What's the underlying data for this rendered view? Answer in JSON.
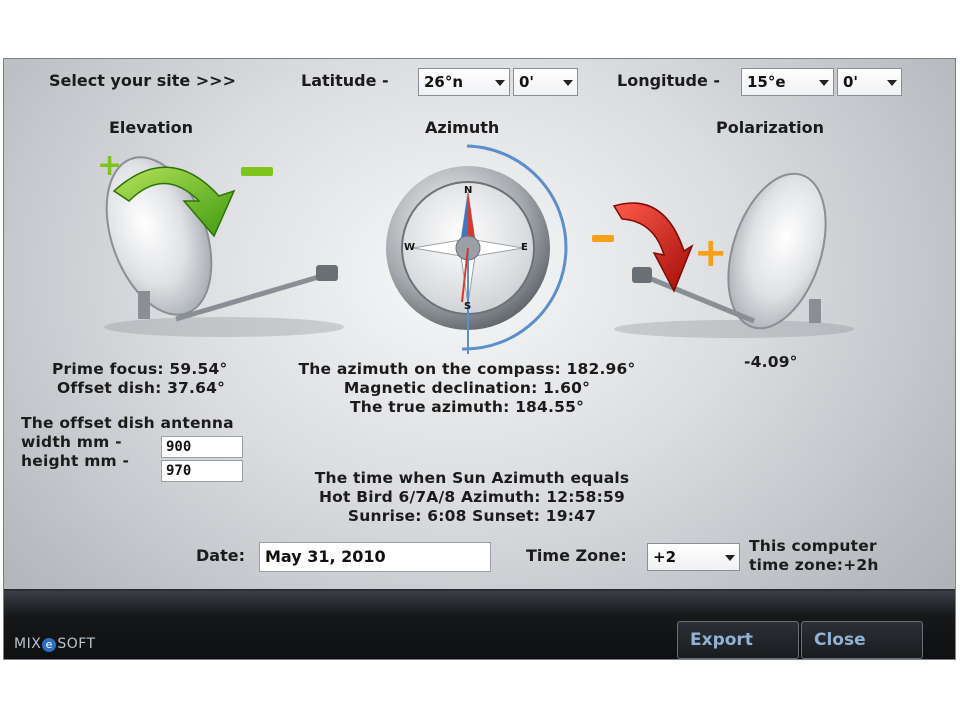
{
  "site": {
    "select_label": "Select your site >>>",
    "latitude_label": "Latitude -",
    "latitude_deg": "26°n",
    "latitude_min": "0'",
    "longitude_label": "Longitude -",
    "longitude_deg": "15°e",
    "longitude_min": "0'"
  },
  "headings": {
    "elevation": "Elevation",
    "azimuth": "Azimuth",
    "polarization": "Polarization"
  },
  "elevation": {
    "plus": "+",
    "minus": "−",
    "prime_focus": "Prime focus: 59.54°",
    "offset_dish": "Offset dish: 37.64°"
  },
  "compass": {
    "north": "N",
    "south": "S",
    "east": "E",
    "west": "W",
    "azimuth_on_compass": "The azimuth on the compass: 182.96°",
    "magnetic_declination": "Magnetic declination: 1.60°",
    "true_azimuth": "The true azimuth: 184.55°"
  },
  "polarization": {
    "minus": "−",
    "plus": "+",
    "value": "-4.09°"
  },
  "antenna": {
    "title": "The offset dish antenna",
    "width_label": "width  mm -",
    "height_label": "height mm -",
    "width_value": "900",
    "height_value": "970"
  },
  "sun": {
    "line1": "The time when Sun Azimuth equals",
    "line2": "Hot Bird 6/7A/8 Azimuth: 12:58:59",
    "line3": "Sunrise: 6:08  Sunset: 19:47"
  },
  "date": {
    "label": "Date:",
    "value": "May 31, 2010"
  },
  "timezone": {
    "label": "Time Zone:",
    "value": "+2",
    "note_line1": "This computer",
    "note_line2": "time zone:+2h"
  },
  "footer": {
    "logo_pre": "MIX",
    "logo_e": "e",
    "logo_post": "SOFT",
    "export_label": "Export",
    "close_label": "Close"
  },
  "colors": {
    "accent_green": "#7fc41a",
    "accent_orange": "#f5a015",
    "accent_red": "#d8201a",
    "compass_arc": "#5a8fcc",
    "button_text": "#8fb2d6"
  }
}
